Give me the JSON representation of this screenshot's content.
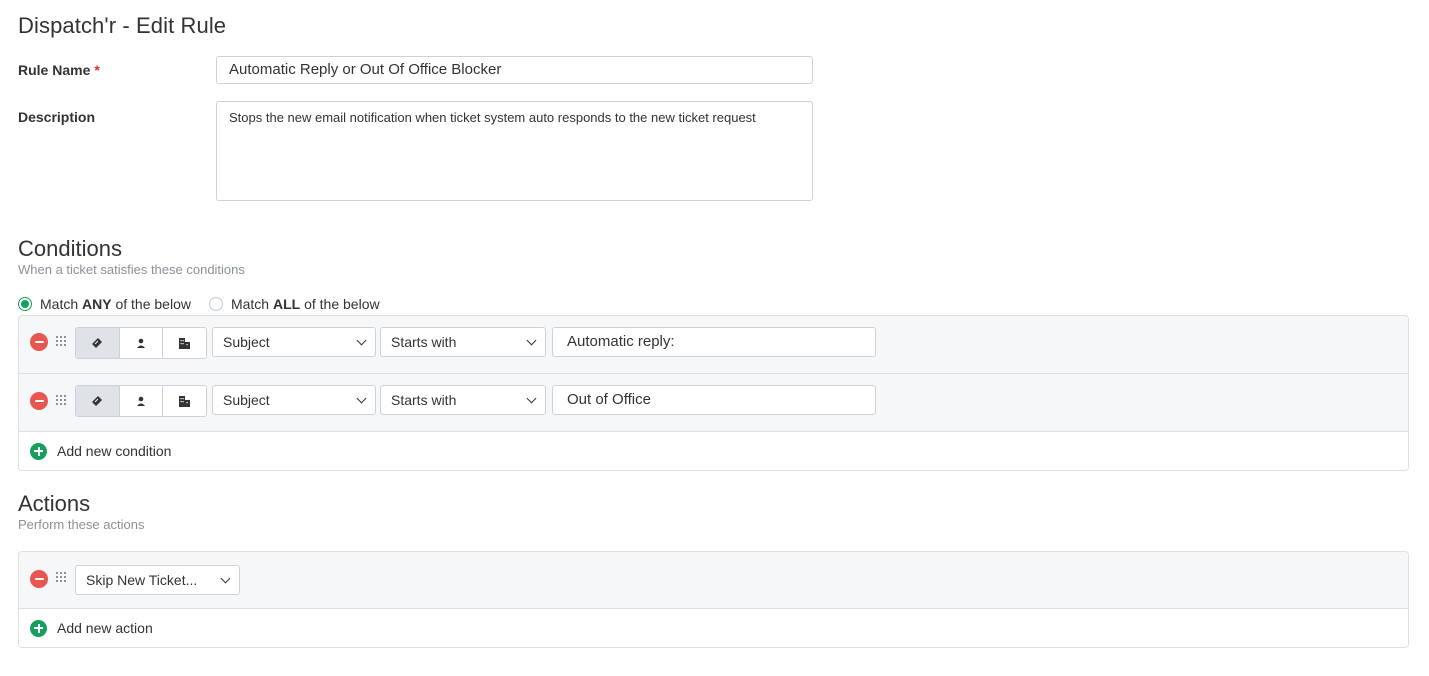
{
  "page": {
    "title": "Dispatch'r - Edit Rule"
  },
  "form": {
    "rule_name_label": "Rule Name",
    "required_mark": "*",
    "rule_name_value": "Automatic Reply or Out Of Office Blocker",
    "description_label": "Description",
    "description_value": "Stops the new email notification when ticket system auto responds to the new ticket request"
  },
  "conditions": {
    "title": "Conditions",
    "subtitle": "When a ticket satisfies these conditions",
    "match_any": {
      "prefix": "Match ",
      "bold": "ANY",
      "suffix": " of the below",
      "selected": true
    },
    "match_all": {
      "prefix": "Match ",
      "bold": "ALL",
      "suffix": " of the below",
      "selected": false
    },
    "rows": [
      {
        "scope": "ticket",
        "field": "Subject",
        "operator": "Starts with",
        "value": "Automatic reply:"
      },
      {
        "scope": "ticket",
        "field": "Subject",
        "operator": "Starts with",
        "value": "Out of Office"
      }
    ],
    "add_label": "Add new condition"
  },
  "actions": {
    "title": "Actions",
    "subtitle": "Perform these actions",
    "rows": [
      {
        "action": "Skip New Ticket..."
      }
    ],
    "add_label": "Add new action"
  },
  "colors": {
    "remove": "#e8574f",
    "add": "#17a05d",
    "radio_selected": "#17a05d",
    "required": "#d9302c"
  },
  "icons": {
    "scope_ticket": "ticket-icon",
    "scope_requester": "person-icon",
    "scope_company": "building-icon",
    "drag": "drag-handle-icon"
  }
}
